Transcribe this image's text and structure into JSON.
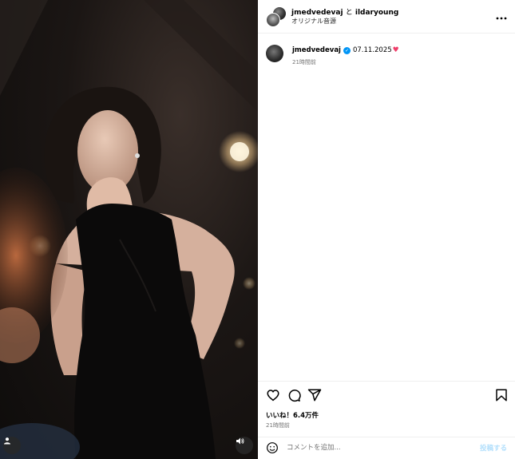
{
  "header": {
    "user1": "jmedvedevaj",
    "and_text": "と",
    "user2": "ildaryoung",
    "audio": "オリジナル音源",
    "more_icon": "more-horizontal-icon"
  },
  "caption": {
    "username": "jmedvedevaj",
    "text": "07.11.2025",
    "emoji": "♥",
    "time": "21時間前"
  },
  "actions": {
    "like_icon": "heart-icon",
    "comment_icon": "comment-icon",
    "share_icon": "send-icon",
    "save_icon": "bookmark-icon",
    "likes": "いいね！6.4万件",
    "time": "21時間前"
  },
  "comment": {
    "placeholder": "コメントを追加...",
    "post_label": "投稿する"
  },
  "colors": {
    "accent": "#0095f6",
    "heart": "#ef3e6a",
    "muted": "#737373"
  }
}
